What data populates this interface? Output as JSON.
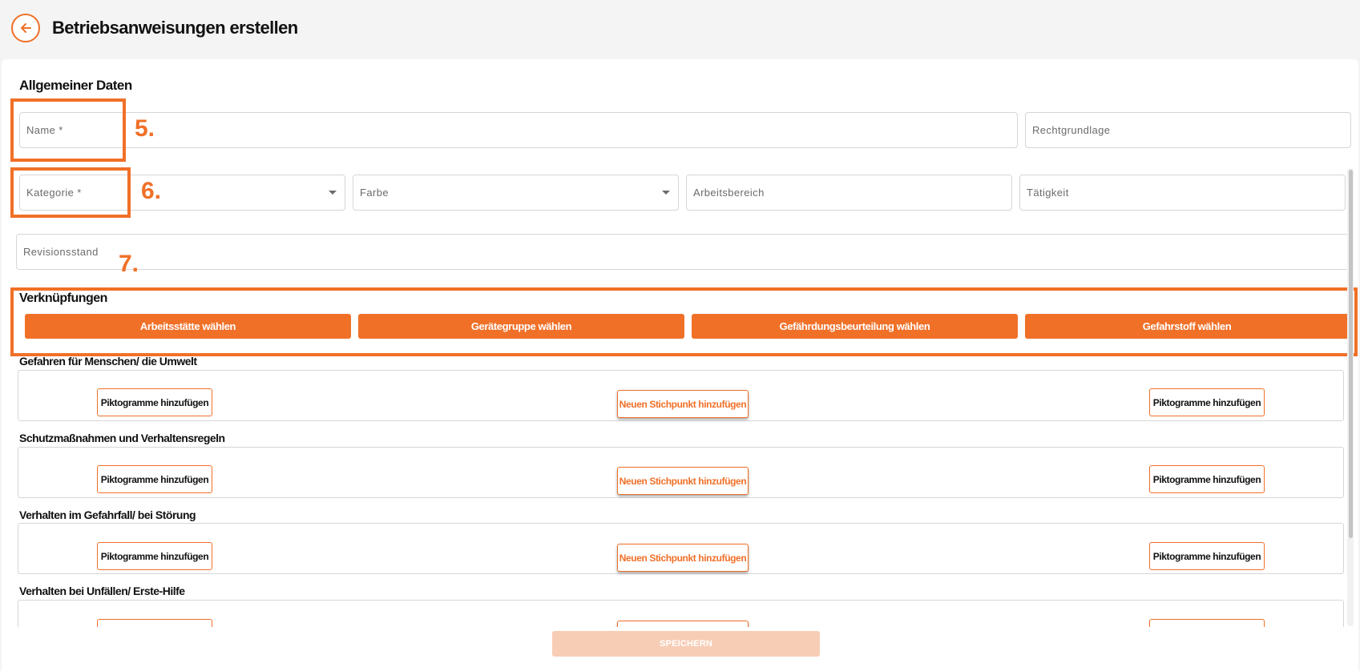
{
  "header": {
    "title": "Betriebsanweisungen erstellen",
    "back_icon": "arrow-left-icon"
  },
  "general": {
    "title": "Allgemeiner Daten",
    "name_placeholder": "Name *",
    "rechtgrundlage_placeholder": "Rechtgrundlage",
    "kategorie_placeholder": "Kategorie *",
    "farbe_placeholder": "Farbe",
    "arbeitsbereich_placeholder": "Arbeitsbereich",
    "taetigkeit_placeholder": "Tätigkeit",
    "revisionsstand_placeholder": "Revisionsstand"
  },
  "annotations": {
    "n5": "5.",
    "n6": "6.",
    "n7": "7."
  },
  "links": {
    "title": "Verknüpfungen",
    "buttons": [
      "Arbeitsstätte wählen",
      "Gerätegruppe wählen",
      "Gefährdungsbeurteilung wählen",
      "Gefahrstoff wählen"
    ]
  },
  "sections": [
    {
      "title": "Gefahren für Menschen/ die Umwelt",
      "picto_left": "Piktogramme hinzufügen",
      "add_point": "Neuen Stichpunkt hinzufügen",
      "picto_right": "Piktogramme hinzufügen"
    },
    {
      "title": "Schutzmaßnahmen und Verhaltensregeln",
      "picto_left": "Piktogramme hinzufügen",
      "add_point": "Neuen Stichpunkt hinzufügen",
      "picto_right": "Piktogramme hinzufügen"
    },
    {
      "title": "Verhalten im Gefahrfall/ bei Störung",
      "picto_left": "Piktogramme hinzufügen",
      "add_point": "Neuen Stichpunkt hinzufügen",
      "picto_right": "Piktogramme hinzufügen"
    },
    {
      "title": "Verhalten bei Unfällen/ Erste-Hilfe"
    }
  ],
  "footer": {
    "save_label": "SPEICHERN"
  },
  "colors": {
    "accent": "#f07028",
    "save_disabled": "#f8cdb6"
  }
}
